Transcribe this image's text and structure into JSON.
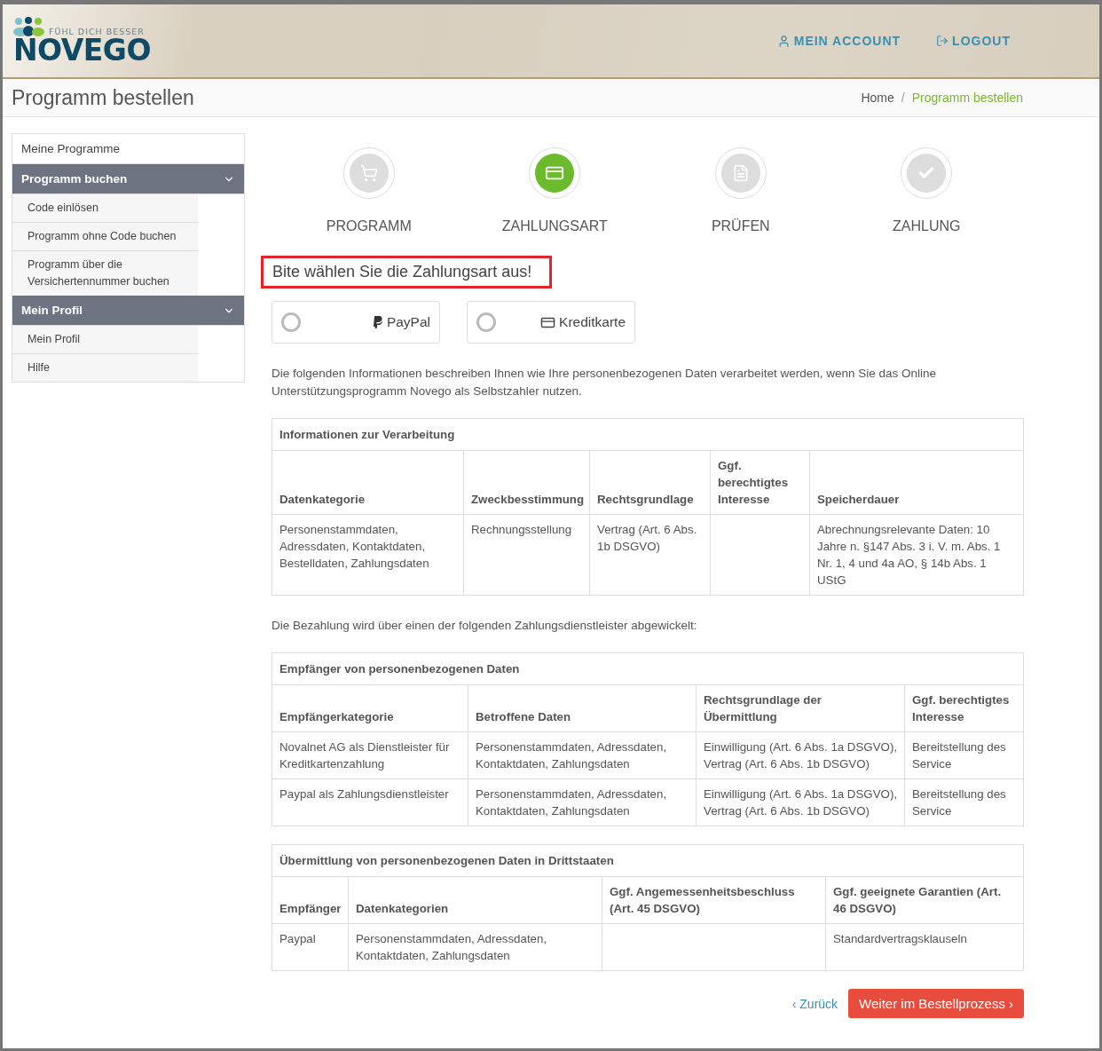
{
  "header": {
    "logo": {
      "tagline": "FÜHL DICH BESSER",
      "name": "NOVEGO"
    },
    "nav": [
      {
        "label": "MEIN ACCOUNT",
        "kind": "account"
      },
      {
        "label": "LOGOUT",
        "kind": "logout"
      }
    ]
  },
  "page_title": "Programm bestellen",
  "breadcrumb": {
    "separator": "/",
    "items": [
      {
        "label": "Home",
        "selected": false
      },
      {
        "label": "Programm bestellen",
        "selected": true
      }
    ]
  },
  "sidebar": {
    "items": [
      {
        "label": "Meine Programme",
        "kind": "link"
      },
      {
        "label": "Programm buchen",
        "kind": "group",
        "expanded": true,
        "children": [
          {
            "label": "Code einlösen"
          },
          {
            "label": "Programm ohne Code buchen"
          },
          {
            "label": "Programm über die Versichertennummer buchen"
          }
        ]
      },
      {
        "label": "Mein Profil",
        "kind": "group",
        "expanded": true,
        "children": [
          {
            "label": "Mein Profil"
          },
          {
            "label": "Hilfe"
          }
        ]
      }
    ]
  },
  "steps": [
    {
      "label": "PROGRAMM",
      "kind": "cart",
      "selected": false
    },
    {
      "label": "ZAHLUNGSART",
      "kind": "card",
      "selected": true
    },
    {
      "label": "PRÜFEN",
      "kind": "document",
      "selected": false
    },
    {
      "label": "ZAHLUNG",
      "kind": "check",
      "selected": false
    }
  ],
  "alert": "Bite wählen Sie die Zahlungsart aus!",
  "payment_options": [
    {
      "label": "PayPal",
      "kind": "paypal",
      "selected": false
    },
    {
      "label": "Kreditkarte",
      "kind": "card",
      "selected": false
    }
  ],
  "intro": "Die folgenden Informationen beschreiben Ihnen wie Ihre personenbezogenen Daten verarbeitet werden, wenn Sie das Online Unterstützungsprogramm Novego als Selbstzahler nutzen.",
  "tables": [
    {
      "title": "Informationen zur Verarbeitung",
      "columns": [
        "Datenkategorie",
        "Zweckbesstimmung",
        "Rechtsgrundlage",
        "Ggf. berechtigtes Interesse",
        "Speicherdauer"
      ],
      "rows": [
        [
          "Personenstammdaten, Adressdaten, Kontaktdaten, Bestelldaten, Zahlungsdaten",
          "Rechnungsstellung",
          "Vertrag (Art. 6 Abs. 1b DSGVO)",
          "",
          "Abrechnungsrelevante Daten: 10 Jahre n. §147 Abs. 3 i. V. m. Abs. 1 Nr. 1, 4 und 4a AO, § 14b Abs. 1 UStG"
        ]
      ],
      "note": "Die Bezahlung wird über einen der folgenden Zahlungsdienstleister abgewickelt:"
    },
    {
      "title": "Empfänger von personenbezogenen Daten",
      "columns": [
        "Empfängerkategorie",
        "Betroffene Daten",
        "Rechtsgrundlage der Übermittlung",
        "Ggf. berechtigtes Interesse"
      ],
      "rows": [
        [
          "Novalnet AG als Dienstleister für Kreditkartenzahlung",
          "Personenstammdaten, Adressdaten, Kontaktdaten, Zahlungsdaten",
          "Einwilligung (Art. 6 Abs. 1a DSGVO), Vertrag (Art. 6 Abs. 1b DSGVO)",
          "Bereitstellung des Service"
        ],
        [
          "Paypal als Zahlungsdienstleister",
          "Personenstammdaten, Adressdaten, Kontaktdaten, Zahlungsdaten",
          "Einwilligung (Art. 6 Abs. 1a DSGVO), Vertrag (Art. 6 Abs. 1b DSGVO)",
          "Bereitstellung des Service"
        ]
      ]
    },
    {
      "title": "Übermittlung von personenbezogenen Daten in Drittstaaten",
      "columns": [
        "Empfänger",
        "Datenkategorien",
        "Ggf. Angemessenheitsbeschluss (Art. 45 DSGVO)",
        "Ggf. geeignete Garantien (Art. 46 DSGVO)"
      ],
      "rows": [
        [
          "Paypal",
          "Personenstammdaten, Adressdaten, Kontaktdaten, Zahlungsdaten",
          "",
          "Standardvertragsklauseln"
        ]
      ]
    }
  ],
  "buttons": [
    {
      "label": "‹ Zurück",
      "kind": "link"
    },
    {
      "label": "Weiter im Bestellprozess ›",
      "kind": "primary"
    }
  ]
}
